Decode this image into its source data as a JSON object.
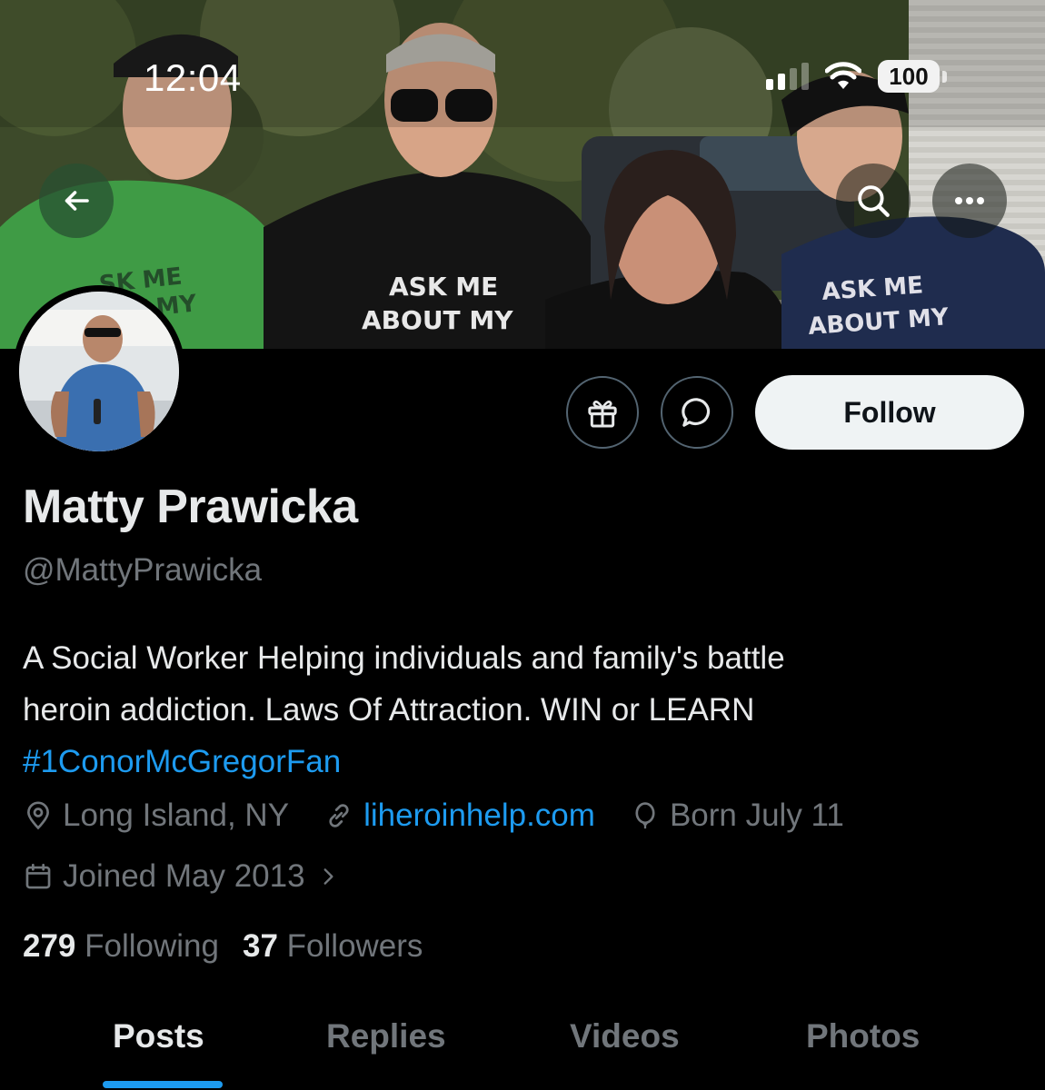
{
  "status_bar": {
    "time": "12:04",
    "battery": "100"
  },
  "header": {
    "back_icon": "arrow-left-icon",
    "search_icon": "search-icon",
    "more_icon": "more-horizontal-icon"
  },
  "banner": {
    "shirt_texts": [
      "ASK ME ABOUT MY",
      "SK ME UT MY EX",
      "ASK ME ABOUT MY NINJA",
      "ASK ME ABOUT MY"
    ]
  },
  "actions": {
    "gift_icon": "gift-icon",
    "message_icon": "message-bubble-icon",
    "follow_label": "Follow"
  },
  "profile": {
    "display_name": "Matty Prawicka",
    "handle": "@MattyPrawicka",
    "bio_line1": "A Social Worker Helping individuals and family's battle",
    "bio_line2": "heroin addiction. Laws Of Attraction. WIN or LEARN",
    "bio_hashtag": "#1ConorMcGregorFan",
    "location": "Long Island, NY",
    "website": "liheroinhelp.com",
    "birthday": "Born July 11",
    "joined": "Joined May 2013"
  },
  "stats": {
    "following_count": "279",
    "following_label": "Following",
    "followers_count": "37",
    "followers_label": "Followers"
  },
  "tabs": [
    {
      "label": "Posts",
      "active": true
    },
    {
      "label": "Replies",
      "active": false
    },
    {
      "label": "Videos",
      "active": false
    },
    {
      "label": "Photos",
      "active": false
    }
  ],
  "colors": {
    "accent": "#1d9bf0",
    "background": "#000000",
    "text_primary": "#e7e9ea",
    "text_secondary": "#71767b"
  }
}
